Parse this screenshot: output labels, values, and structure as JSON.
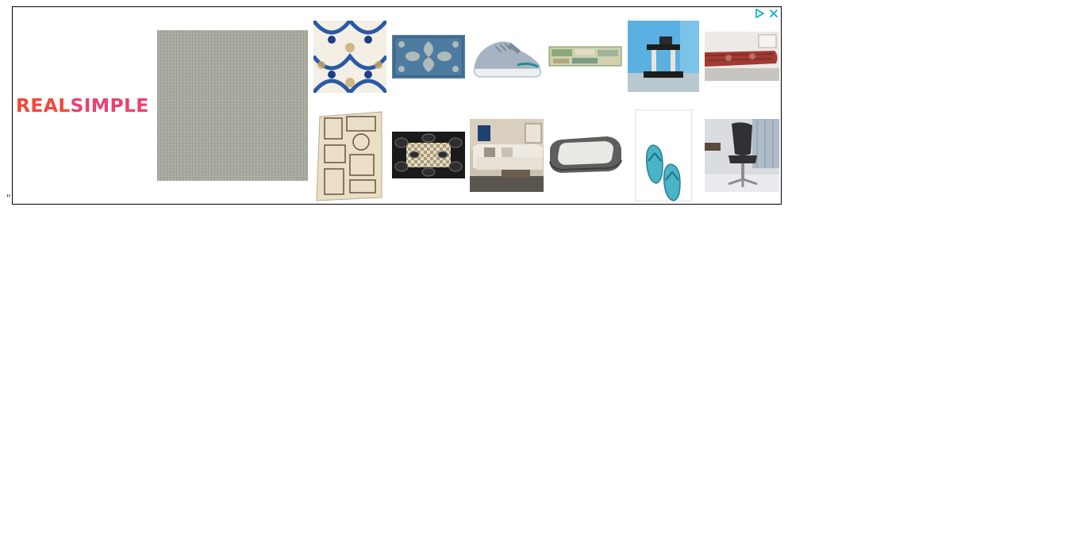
{
  "stray_text": "\"",
  "ad": {
    "brand": {
      "word1": "REAL",
      "word2": "SIMPLE"
    },
    "icons": {
      "adchoices": "adchoices-icon",
      "close": "close-icon"
    },
    "colors": {
      "brand_primary": "#ef4a3c",
      "brand_secondary": "#e8436f",
      "adchoices": "#00aecd"
    },
    "products": [
      "linen-fabric-swatch",
      "blue-floral-tile",
      "blue-damask-rug",
      "grey-sneaker",
      "vintage-sign",
      "cat-tree",
      "red-bench-cushion",
      "vintage-illustration-print",
      "checkered-doormat",
      "white-sofa",
      "grey-pet-bed",
      "flip-flops-towel",
      "black-office-chair"
    ]
  }
}
